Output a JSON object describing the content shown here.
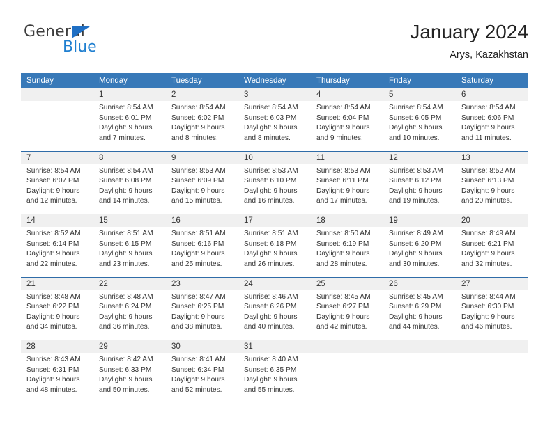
{
  "brand": {
    "general": "General",
    "blue": "Blue",
    "triangle_color": "#1f6fc4",
    "blue_color": "#1f7fd0"
  },
  "header": {
    "month_title": "January 2024",
    "location": "Arys, Kazakhstan"
  },
  "colors": {
    "header_bar": "#3879b8",
    "daynum_band": "#f0f0f0",
    "week_separator": "#2f6ca8",
    "text": "#333333"
  },
  "weekday_headers": [
    "Sunday",
    "Monday",
    "Tuesday",
    "Wednesday",
    "Thursday",
    "Friday",
    "Saturday"
  ],
  "weeks": [
    [
      {
        "day": "",
        "sunrise": "",
        "sunset": "",
        "daylight_1": "",
        "daylight_2": ""
      },
      {
        "day": "1",
        "sunrise": "Sunrise: 8:54 AM",
        "sunset": "Sunset: 6:01 PM",
        "daylight_1": "Daylight: 9 hours",
        "daylight_2": "and 7 minutes."
      },
      {
        "day": "2",
        "sunrise": "Sunrise: 8:54 AM",
        "sunset": "Sunset: 6:02 PM",
        "daylight_1": "Daylight: 9 hours",
        "daylight_2": "and 8 minutes."
      },
      {
        "day": "3",
        "sunrise": "Sunrise: 8:54 AM",
        "sunset": "Sunset: 6:03 PM",
        "daylight_1": "Daylight: 9 hours",
        "daylight_2": "and 8 minutes."
      },
      {
        "day": "4",
        "sunrise": "Sunrise: 8:54 AM",
        "sunset": "Sunset: 6:04 PM",
        "daylight_1": "Daylight: 9 hours",
        "daylight_2": "and 9 minutes."
      },
      {
        "day": "5",
        "sunrise": "Sunrise: 8:54 AM",
        "sunset": "Sunset: 6:05 PM",
        "daylight_1": "Daylight: 9 hours",
        "daylight_2": "and 10 minutes."
      },
      {
        "day": "6",
        "sunrise": "Sunrise: 8:54 AM",
        "sunset": "Sunset: 6:06 PM",
        "daylight_1": "Daylight: 9 hours",
        "daylight_2": "and 11 minutes."
      }
    ],
    [
      {
        "day": "7",
        "sunrise": "Sunrise: 8:54 AM",
        "sunset": "Sunset: 6:07 PM",
        "daylight_1": "Daylight: 9 hours",
        "daylight_2": "and 12 minutes."
      },
      {
        "day": "8",
        "sunrise": "Sunrise: 8:54 AM",
        "sunset": "Sunset: 6:08 PM",
        "daylight_1": "Daylight: 9 hours",
        "daylight_2": "and 14 minutes."
      },
      {
        "day": "9",
        "sunrise": "Sunrise: 8:53 AM",
        "sunset": "Sunset: 6:09 PM",
        "daylight_1": "Daylight: 9 hours",
        "daylight_2": "and 15 minutes."
      },
      {
        "day": "10",
        "sunrise": "Sunrise: 8:53 AM",
        "sunset": "Sunset: 6:10 PM",
        "daylight_1": "Daylight: 9 hours",
        "daylight_2": "and 16 minutes."
      },
      {
        "day": "11",
        "sunrise": "Sunrise: 8:53 AM",
        "sunset": "Sunset: 6:11 PM",
        "daylight_1": "Daylight: 9 hours",
        "daylight_2": "and 17 minutes."
      },
      {
        "day": "12",
        "sunrise": "Sunrise: 8:53 AM",
        "sunset": "Sunset: 6:12 PM",
        "daylight_1": "Daylight: 9 hours",
        "daylight_2": "and 19 minutes."
      },
      {
        "day": "13",
        "sunrise": "Sunrise: 8:52 AM",
        "sunset": "Sunset: 6:13 PM",
        "daylight_1": "Daylight: 9 hours",
        "daylight_2": "and 20 minutes."
      }
    ],
    [
      {
        "day": "14",
        "sunrise": "Sunrise: 8:52 AM",
        "sunset": "Sunset: 6:14 PM",
        "daylight_1": "Daylight: 9 hours",
        "daylight_2": "and 22 minutes."
      },
      {
        "day": "15",
        "sunrise": "Sunrise: 8:51 AM",
        "sunset": "Sunset: 6:15 PM",
        "daylight_1": "Daylight: 9 hours",
        "daylight_2": "and 23 minutes."
      },
      {
        "day": "16",
        "sunrise": "Sunrise: 8:51 AM",
        "sunset": "Sunset: 6:16 PM",
        "daylight_1": "Daylight: 9 hours",
        "daylight_2": "and 25 minutes."
      },
      {
        "day": "17",
        "sunrise": "Sunrise: 8:51 AM",
        "sunset": "Sunset: 6:18 PM",
        "daylight_1": "Daylight: 9 hours",
        "daylight_2": "and 26 minutes."
      },
      {
        "day": "18",
        "sunrise": "Sunrise: 8:50 AM",
        "sunset": "Sunset: 6:19 PM",
        "daylight_1": "Daylight: 9 hours",
        "daylight_2": "and 28 minutes."
      },
      {
        "day": "19",
        "sunrise": "Sunrise: 8:49 AM",
        "sunset": "Sunset: 6:20 PM",
        "daylight_1": "Daylight: 9 hours",
        "daylight_2": "and 30 minutes."
      },
      {
        "day": "20",
        "sunrise": "Sunrise: 8:49 AM",
        "sunset": "Sunset: 6:21 PM",
        "daylight_1": "Daylight: 9 hours",
        "daylight_2": "and 32 minutes."
      }
    ],
    [
      {
        "day": "21",
        "sunrise": "Sunrise: 8:48 AM",
        "sunset": "Sunset: 6:22 PM",
        "daylight_1": "Daylight: 9 hours",
        "daylight_2": "and 34 minutes."
      },
      {
        "day": "22",
        "sunrise": "Sunrise: 8:48 AM",
        "sunset": "Sunset: 6:24 PM",
        "daylight_1": "Daylight: 9 hours",
        "daylight_2": "and 36 minutes."
      },
      {
        "day": "23",
        "sunrise": "Sunrise: 8:47 AM",
        "sunset": "Sunset: 6:25 PM",
        "daylight_1": "Daylight: 9 hours",
        "daylight_2": "and 38 minutes."
      },
      {
        "day": "24",
        "sunrise": "Sunrise: 8:46 AM",
        "sunset": "Sunset: 6:26 PM",
        "daylight_1": "Daylight: 9 hours",
        "daylight_2": "and 40 minutes."
      },
      {
        "day": "25",
        "sunrise": "Sunrise: 8:45 AM",
        "sunset": "Sunset: 6:27 PM",
        "daylight_1": "Daylight: 9 hours",
        "daylight_2": "and 42 minutes."
      },
      {
        "day": "26",
        "sunrise": "Sunrise: 8:45 AM",
        "sunset": "Sunset: 6:29 PM",
        "daylight_1": "Daylight: 9 hours",
        "daylight_2": "and 44 minutes."
      },
      {
        "day": "27",
        "sunrise": "Sunrise: 8:44 AM",
        "sunset": "Sunset: 6:30 PM",
        "daylight_1": "Daylight: 9 hours",
        "daylight_2": "and 46 minutes."
      }
    ],
    [
      {
        "day": "28",
        "sunrise": "Sunrise: 8:43 AM",
        "sunset": "Sunset: 6:31 PM",
        "daylight_1": "Daylight: 9 hours",
        "daylight_2": "and 48 minutes."
      },
      {
        "day": "29",
        "sunrise": "Sunrise: 8:42 AM",
        "sunset": "Sunset: 6:33 PM",
        "daylight_1": "Daylight: 9 hours",
        "daylight_2": "and 50 minutes."
      },
      {
        "day": "30",
        "sunrise": "Sunrise: 8:41 AM",
        "sunset": "Sunset: 6:34 PM",
        "daylight_1": "Daylight: 9 hours",
        "daylight_2": "and 52 minutes."
      },
      {
        "day": "31",
        "sunrise": "Sunrise: 8:40 AM",
        "sunset": "Sunset: 6:35 PM",
        "daylight_1": "Daylight: 9 hours",
        "daylight_2": "and 55 minutes."
      },
      {
        "day": "",
        "sunrise": "",
        "sunset": "",
        "daylight_1": "",
        "daylight_2": ""
      },
      {
        "day": "",
        "sunrise": "",
        "sunset": "",
        "daylight_1": "",
        "daylight_2": ""
      },
      {
        "day": "",
        "sunrise": "",
        "sunset": "",
        "daylight_1": "",
        "daylight_2": ""
      }
    ]
  ]
}
